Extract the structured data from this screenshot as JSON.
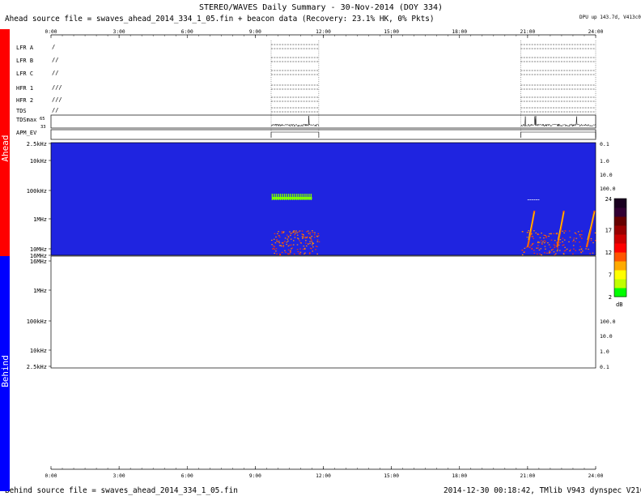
{
  "header": {
    "title": "STEREO/WAVES Daily Summary - 30-Nov-2014 (DOY 334)",
    "ahead_source": "Ahead source file = swaves_ahead_2014_334_1_05.fin + beacon data (Recovery: 23.1% HK,   0% Pkts)",
    "dpu_note": "DPU up 143.7d, V413c08"
  },
  "footer": {
    "behind_source": "Behind source file = swaves_ahead_2014_334_1_05.fin",
    "version": "2014-12-30 00:18:42, TMlib V943 dynspec V210"
  },
  "side_labels": {
    "ahead": "Ahead",
    "behind": "Behind"
  },
  "colors": {
    "ahead_bar": "#ff0000",
    "behind_bar": "#0000ff",
    "background_fill": "#1f24e0",
    "burst": "#7cff00"
  },
  "chart_data": [
    {
      "type": "timeline",
      "x_ticks": [
        "0:00",
        "3:00",
        "6:00",
        "9:00",
        "12:00",
        "15:00",
        "18:00",
        "21:00",
        "24:00"
      ],
      "xlim_hours": [
        0,
        24
      ],
      "rows": [
        {
          "label": "LFR A",
          "mark": "/"
        },
        {
          "label": "LFR B",
          "mark": "//"
        },
        {
          "label": "LFR C",
          "mark": "//"
        },
        {
          "label": "HFR 1",
          "mark": "///"
        },
        {
          "label": "HFR 2",
          "mark": "///"
        },
        {
          "label": "TDS",
          "mark": "//"
        },
        {
          "label": "TDSmax",
          "mark": ""
        },
        {
          "label": "APM_EV",
          "mark": ""
        }
      ],
      "tdsmax_ticks": [
        "65",
        "33"
      ],
      "data_intervals_hours": [
        [
          9.7,
          11.8
        ],
        [
          20.7,
          24.0
        ]
      ]
    },
    {
      "type": "heatmap",
      "panel": "Ahead",
      "y_ticks_left": [
        "2.5kHz",
        "10kHz",
        "100kHz",
        "1MHz",
        "10MHz",
        "16MHz"
      ],
      "y_ticks_right": [
        "0.1",
        "1.0",
        "10.0",
        "100.0"
      ],
      "colorbar": {
        "ticks": [
          "2",
          "7",
          "12",
          "17",
          "24"
        ],
        "unit": "dB",
        "range": [
          2,
          24
        ]
      },
      "bursts": [
        {
          "start_h": 21.0,
          "end_h": 21.3,
          "freq_MHz": [
            0.5,
            6
          ]
        },
        {
          "start_h": 22.3,
          "end_h": 22.6,
          "freq_MHz": [
            0.5,
            5
          ]
        },
        {
          "start_h": 23.6,
          "end_h": 23.95,
          "freq_MHz": [
            0.3,
            3
          ]
        }
      ]
    },
    {
      "type": "heatmap",
      "panel": "Behind",
      "y_ticks_left": [
        "16MHz",
        "10MHz",
        "1MHz",
        "100kHz",
        "10kHz",
        "2.5kHz"
      ],
      "y_ticks_right": [
        "100.0",
        "10.0",
        "1.0",
        "0.1"
      ],
      "x_ticks": [
        "0:00",
        "3:00",
        "6:00",
        "9:00",
        "12:00",
        "15:00",
        "18:00",
        "21:00",
        "24:00"
      ]
    }
  ]
}
